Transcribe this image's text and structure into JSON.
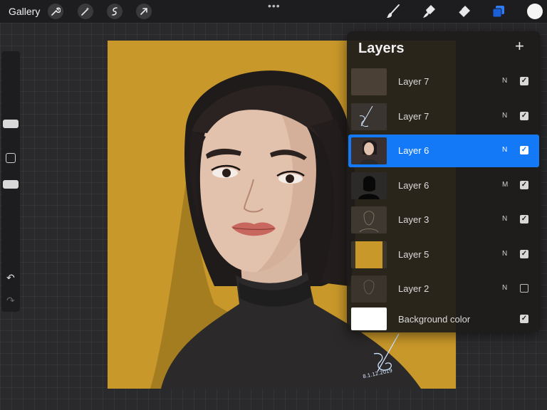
{
  "topbar": {
    "gallery_label": "Gallery",
    "tools_left": [
      "wrench-icon",
      "magic-wand-icon",
      "selection-icon",
      "transform-arrow-icon"
    ],
    "more_dots": "•••",
    "tools_right": [
      "brush-icon",
      "smudge-icon",
      "eraser-icon",
      "layers-icon"
    ],
    "current_color": "#f5f5f5"
  },
  "sidebar": {
    "undo_icon": "↶",
    "redo_icon": "↷"
  },
  "layers": {
    "title": "Layers",
    "add_icon": "+",
    "items": [
      {
        "name": "Layer 7",
        "blend": "N",
        "visible": true,
        "selected": false,
        "thumb": "brown-fill"
      },
      {
        "name": "Layer 7",
        "blend": "N",
        "visible": true,
        "selected": false,
        "thumb": "signature"
      },
      {
        "name": "Layer 6",
        "blend": "N",
        "visible": true,
        "selected": true,
        "thumb": "portrait"
      },
      {
        "name": "Layer 6",
        "blend": "M",
        "visible": true,
        "selected": false,
        "thumb": "silhouette"
      },
      {
        "name": "Layer 3",
        "blend": "N",
        "visible": true,
        "selected": false,
        "thumb": "sketch"
      },
      {
        "name": "Layer 5",
        "blend": "N",
        "visible": true,
        "selected": false,
        "thumb": "mustard-fill"
      },
      {
        "name": "Layer 2",
        "blend": "N",
        "visible": false,
        "selected": false,
        "thumb": "sketch"
      },
      {
        "name": "Background color",
        "blend": "",
        "visible": true,
        "selected": false,
        "thumb": "white-fill"
      }
    ]
  },
  "canvas": {
    "background_color": "#c9982a",
    "signature_text": "8.1.12.2019"
  },
  "colors": {
    "accent": "#1479f6",
    "panel": "#1e1c1a"
  }
}
